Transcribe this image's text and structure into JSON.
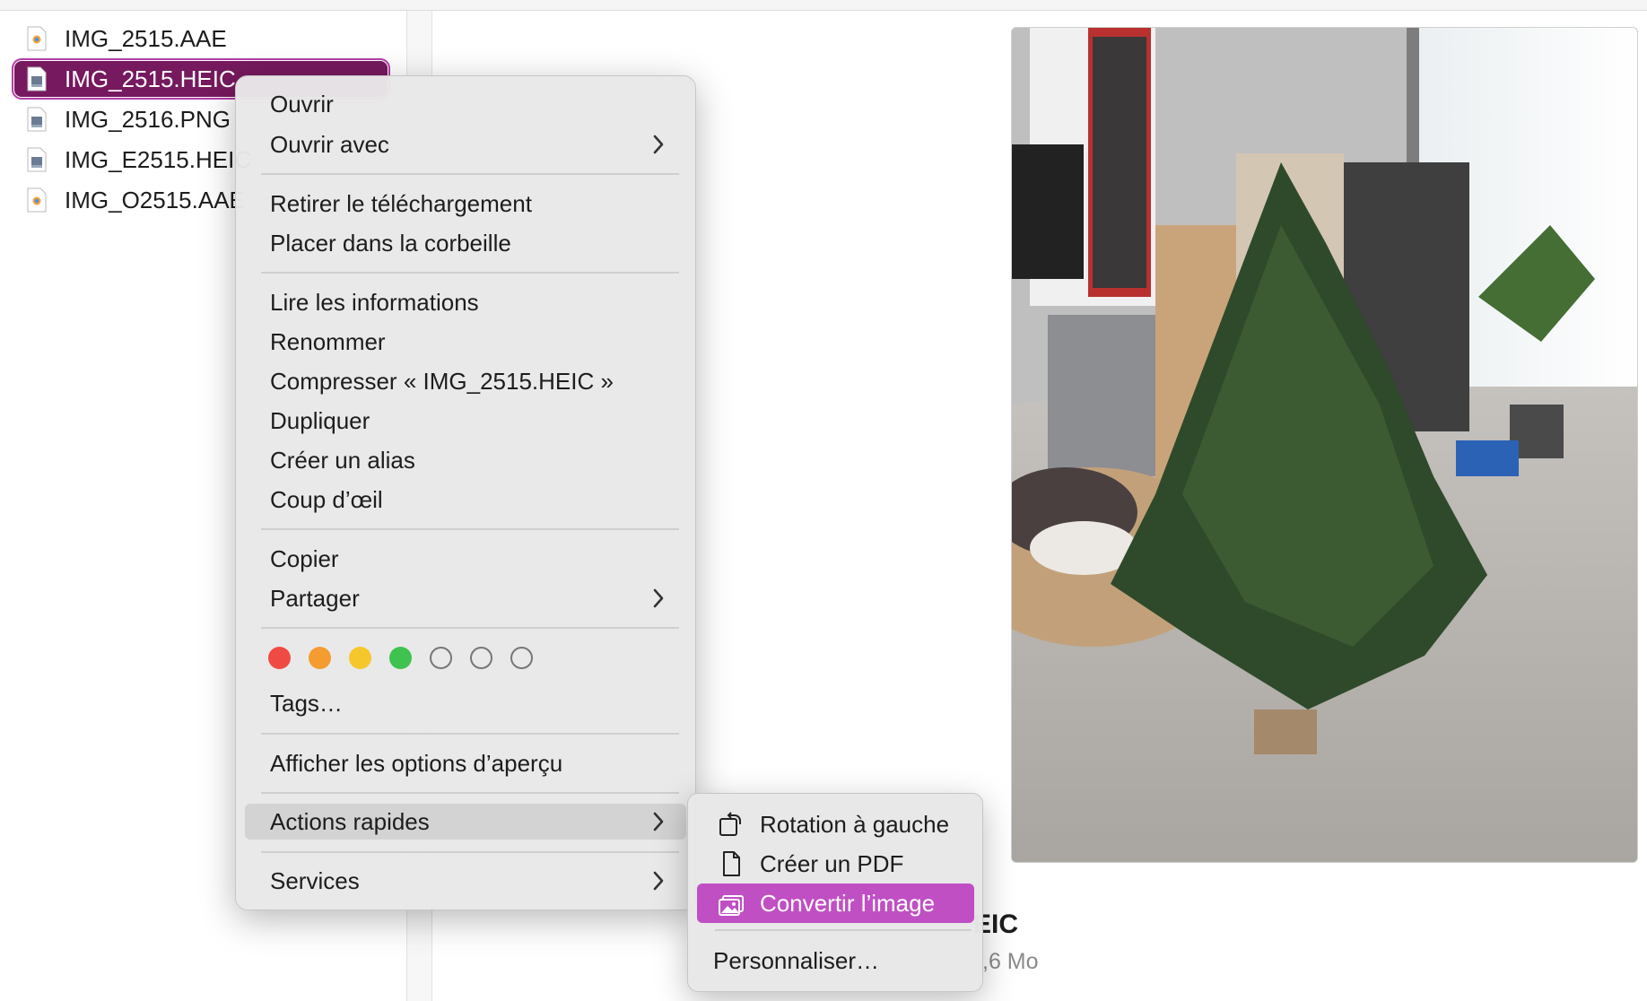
{
  "files": [
    {
      "name": "IMG_2515.AAE",
      "icon": "aae-file-icon",
      "selected": false
    },
    {
      "name": "IMG_2515.HEIC",
      "icon": "heic-file-icon",
      "selected": true
    },
    {
      "name": "IMG_2516.PNG",
      "icon": "png-file-icon",
      "selected": false
    },
    {
      "name": "IMG_E2515.HEIC",
      "icon": "heic-file-icon",
      "selected": false
    },
    {
      "name": "IMG_O2515.AAE",
      "icon": "aae-file-icon",
      "selected": false
    }
  ],
  "menu": {
    "open": "Ouvrir",
    "open_with": "Ouvrir avec",
    "remove_download": "Retirer le téléchargement",
    "move_to_trash": "Placer dans la corbeille",
    "get_info": "Lire les informations",
    "rename": "Renommer",
    "compress": "Compresser « IMG_2515.HEIC »",
    "duplicate": "Dupliquer",
    "make_alias": "Créer un alias",
    "quick_look": "Coup d’œil",
    "copy": "Copier",
    "share": "Partager",
    "tags_label": "Tags…",
    "show_preview_options": "Afficher les options d’aperçu",
    "quick_actions": "Actions rapides",
    "services": "Services"
  },
  "tag_colors": [
    "#f04a45",
    "#f49c2f",
    "#f6c72c",
    "#3fc24f",
    "none",
    "none",
    "none"
  ],
  "quick_actions_submenu": {
    "rotate_left": "Rotation à gauche",
    "create_pdf": "Créer un PDF",
    "convert_image": "Convertir l’image",
    "customize": "Personnaliser…"
  },
  "preview": {
    "name_fragment": "EIC",
    "size_fragment": ",6 Mo"
  },
  "colors": {
    "selection": "#76195e",
    "submenu_highlight": "#c04fc4"
  }
}
